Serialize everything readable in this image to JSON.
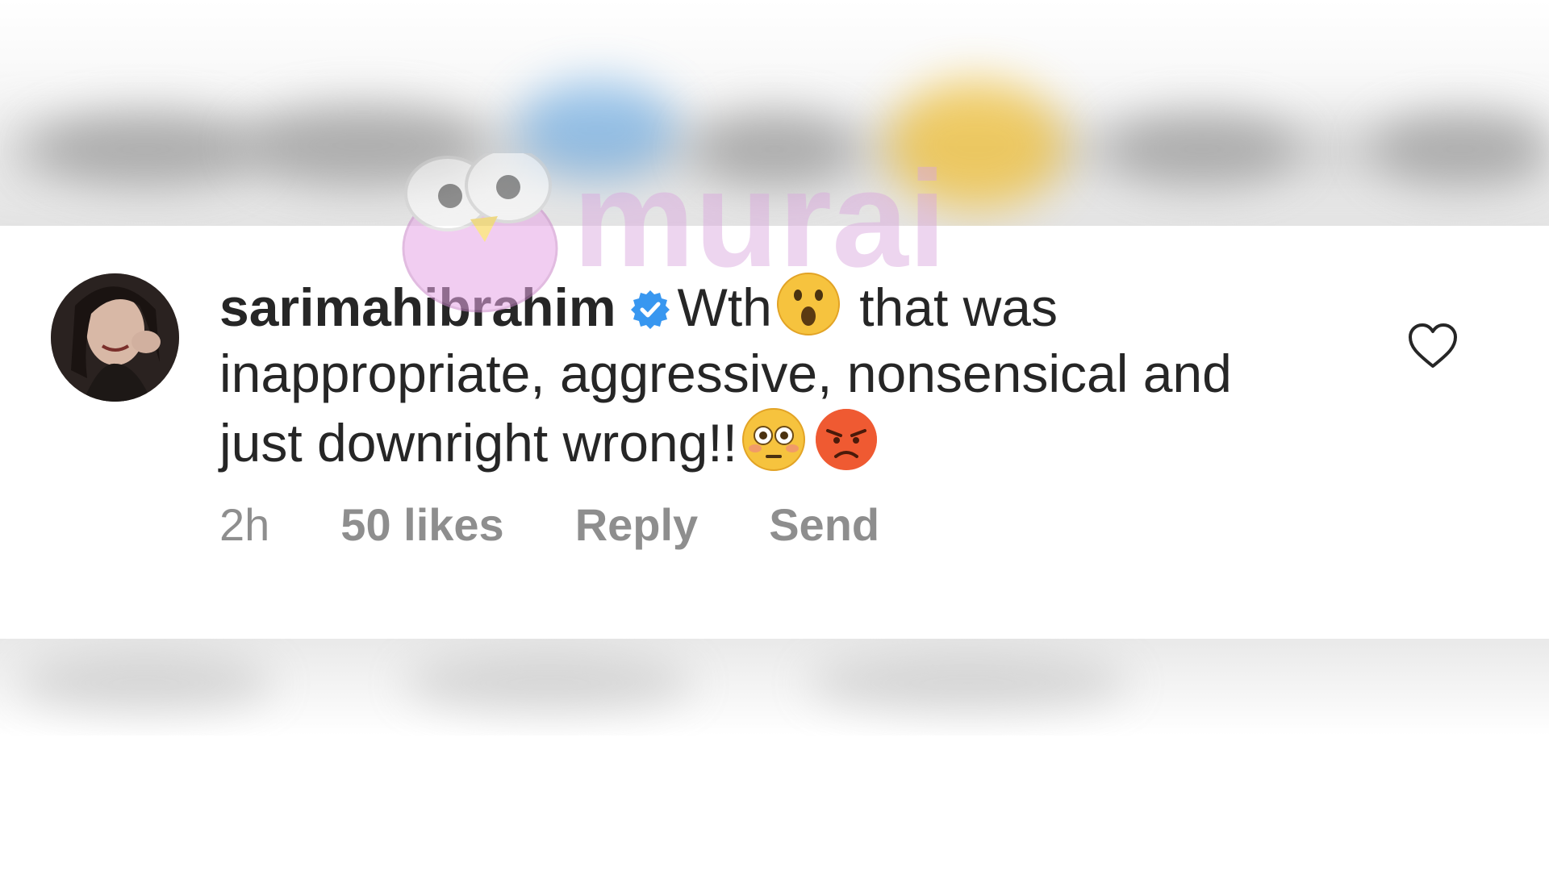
{
  "watermark": {
    "text": "murai"
  },
  "comment": {
    "username": "sarimahibrahim",
    "verified": true,
    "text_part1": "Wth",
    "emoji1": "astonished-face",
    "text_part2": "that was inappropriate, aggressive, nonsensical and just downright wrong!!",
    "emoji2": "flushed-face",
    "emoji3": "angry-face",
    "time": "2h",
    "likes": "50 likes",
    "reply_label": "Reply",
    "send_label": "Send"
  },
  "colors": {
    "text": "#262626",
    "secondary": "#8e8e8e",
    "verified_blue": "#3897f0",
    "watermark_pink": "#d8a7dc"
  }
}
